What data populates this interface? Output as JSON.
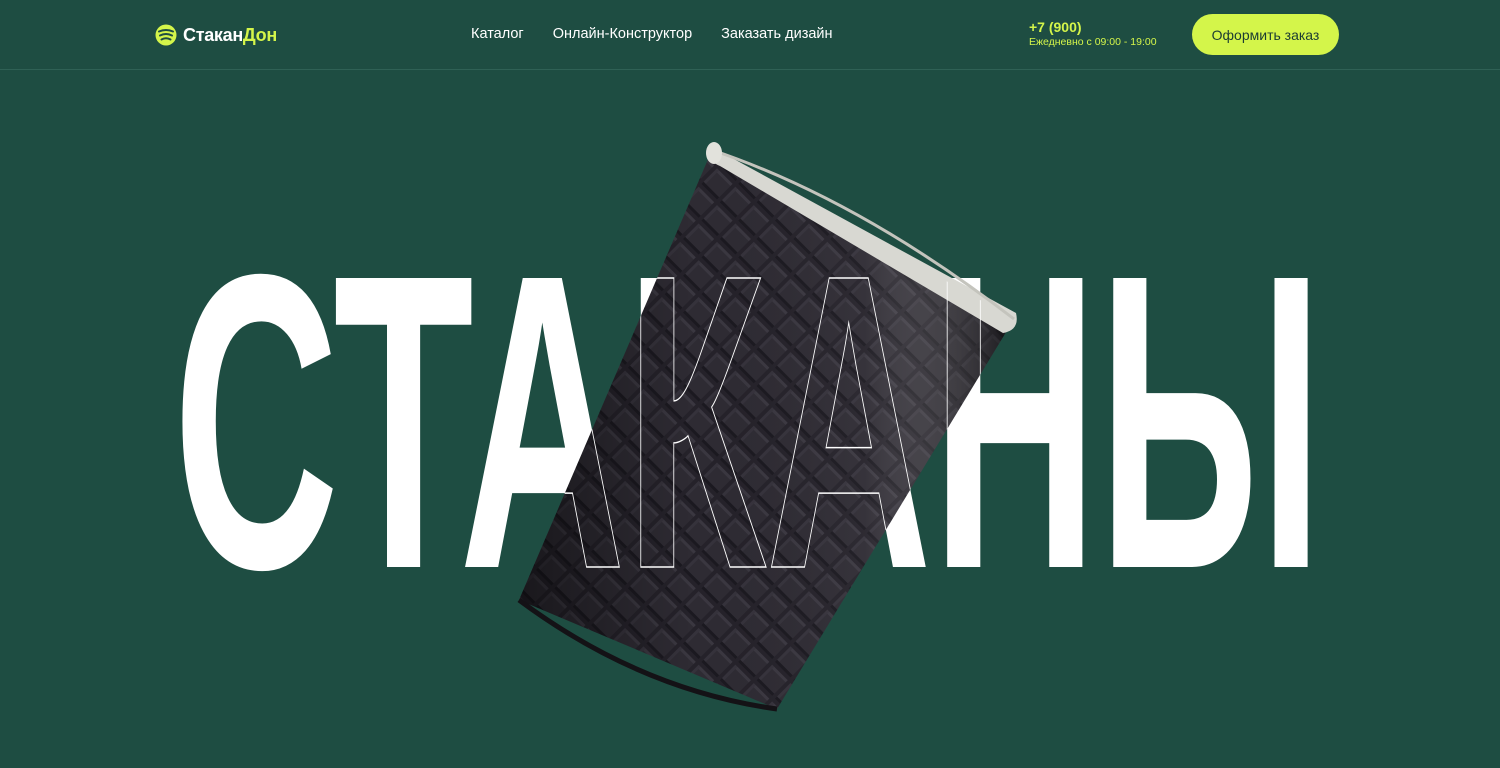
{
  "header": {
    "logo": {
      "part1": "Стакан",
      "part2": "Дон"
    },
    "nav": [
      {
        "label": "Каталог"
      },
      {
        "label": "Онлайн-Конструктор"
      },
      {
        "label": "Заказать дизайн"
      }
    ],
    "contact": {
      "phone": "+7 (900)",
      "hours": "Ежедневно с 09:00 - 19:00"
    },
    "order_button": "Оформить заказ"
  },
  "hero": {
    "title": "СТАКАНЫ",
    "image": "black-textured-paper-cup"
  },
  "colors": {
    "background": "#1e4d42",
    "accent": "#d4f54a",
    "text": "#ffffff",
    "cup": "#25222a"
  }
}
